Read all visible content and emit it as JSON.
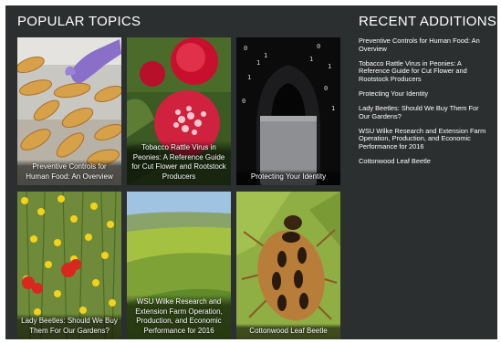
{
  "popular": {
    "title": "POPULAR TOPICS",
    "topics": [
      {
        "caption": "Preventive Controls for Human Food: An Overview"
      },
      {
        "caption": "Tobacco Rattle Virus in Peonies: A Reference Guide for Cut Flower and Rootstock Producers"
      },
      {
        "caption": "Protecting Your Identity"
      },
      {
        "caption": "Lady Beetles: Should We Buy Them For Our Gardens?"
      },
      {
        "caption": "WSU Wilke Research and Extension Farm Operation, Production, and Economic Performance for 2016"
      },
      {
        "caption": "Cottonwood Leaf Beetle"
      }
    ]
  },
  "recent": {
    "title": "RECENT ADDITIONS",
    "items": [
      {
        "label": "Preventive Controls for Human Food: An Overview"
      },
      {
        "label": "Tobacco Rattle Virus in Peonies: A Reference Guide for Cut Flower and Rootstock Producers"
      },
      {
        "label": "Protecting Your Identity"
      },
      {
        "label": "Lady Beetles: Should We Buy Them For Our Gardens?"
      },
      {
        "label": "WSU Wilke Research and Extension Farm Operation, Production, and Economic Performance for 2016"
      },
      {
        "label": "Cottonwood Leaf Beetle"
      }
    ]
  },
  "colors": {
    "panel_background": "#2c2f30",
    "text": "#ffffff"
  }
}
